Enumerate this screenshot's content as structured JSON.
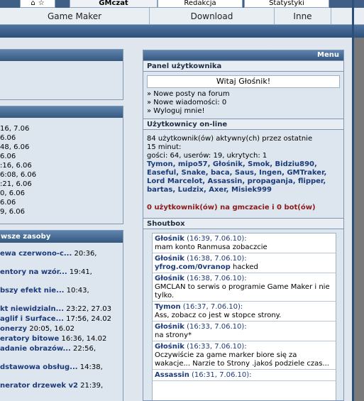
{
  "top_tabs": {
    "active": "GMczat",
    "items": [
      "GMczat",
      "Redakcja",
      "Statystyki"
    ]
  },
  "nav": {
    "items": [
      "Game Maker",
      "Download",
      "Inne"
    ]
  },
  "left": {
    "stats_rows": [
      "16, 7.06",
      "6.06",
      "48, 6.06",
      "6.06",
      ":16, 6.06",
      "6:08, 6.06",
      ":21, 6.06",
      "0, 6.06",
      "6.06",
      "9, 6.06"
    ],
    "resources_title": "wsze zasoby",
    "resources": [
      {
        "title": "ewa czerwono-c...",
        "date": "20:36,"
      },
      {
        "title": "entory na wzór...",
        "date": "19:41,"
      },
      {
        "title": "bszy efekt nie...",
        "date": "10:43,"
      },
      {
        "title": "kt niewidzialn...",
        "date": "23:22, 27.03"
      },
      {
        "title": "aglif i Surface...",
        "date": "17:56, 24.02"
      },
      {
        "title": "onerzy",
        "date": "20:05, 16.02"
      },
      {
        "title": "eratory bitowe",
        "date": "16:36, 14.02"
      },
      {
        "title": "adanie obrazów...",
        "date": "22:56,"
      },
      {
        "title": "dstawowa obsług...",
        "date": "14:38,"
      },
      {
        "title": "nerator drzewek v2",
        "date": "21:39,"
      }
    ]
  },
  "menu": {
    "title": "Menu",
    "user_panel": {
      "title": "Panel użytkownika",
      "welcome": "Witaj Głośnik!",
      "links": [
        "» Nowe posty na forum",
        "» Nowe wiadomości: 0",
        "» Wyloguj mnie!"
      ]
    },
    "online": {
      "title": "Użytkownicy on-line",
      "summary_1": "84 użytkownik(ów) aktywny(ch) przez ostatnie",
      "summary_2": "15 minut:",
      "summary_3": "gości: 64, userów: 19, ukrytych: 1",
      "users_1": "Tymon, mipo57, Głośnik, Smok, Bidziu890,",
      "users_2": "Easeful, Snake, baca, Saus, Ingen, GMTraker,",
      "users_3": "Lord Marcelot, Assassin, propaganja, flipper,",
      "users_4": "bartas, Ludzix, Axer, Misiek999",
      "gmczat": "0 użytkownik(ów) na gmczacie i 0 bot(ów)"
    },
    "shoutbox": {
      "title": "Shoutbox",
      "items": [
        {
          "author": "Głośnik",
          "meta": "(16:39, 7.06.10):",
          "text": "mam konto Ranmusa zobaczcie"
        },
        {
          "author": "Głośnik",
          "meta": "(16:38, 7.06.10):",
          "link": "yfrog.com/0vranop",
          "text": " hacked"
        },
        {
          "author": "Głośnik",
          "meta": "(16:38, 7.06.10):",
          "text": "GMCLAN to serwis o programie Game Maker i nie tylko."
        },
        {
          "author": "Tymon",
          "meta": "(16:37, 7.06.10):",
          "text": "Ass, zobacz co jest w stopce strony."
        },
        {
          "author": "Głośnik",
          "meta": "(16:33, 7.06.10):",
          "text": "na strony*"
        },
        {
          "author": "Głośnik",
          "meta": "(16:33, 7.06.10):",
          "text": "Oczywiście za game marker biore się za wakacje... Narzie to Strony .jakoś podziele czas..."
        },
        {
          "author": "Assassin",
          "meta": "(16:31, 7.06.10):",
          "text": ""
        }
      ]
    }
  }
}
